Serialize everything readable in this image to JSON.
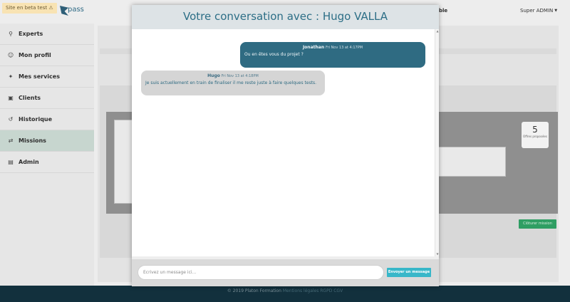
{
  "banner": {
    "text": "Site en beta test",
    "icon": "warning-icon"
  },
  "brand": {
    "logo_text": "pass"
  },
  "top_nav": {
    "partial_label": "ble"
  },
  "user_menu": {
    "label": "Super ADMIN"
  },
  "sidebar": {
    "items": [
      {
        "label": "Experts",
        "icon": "search-icon"
      },
      {
        "label": "Mon profil",
        "icon": "user-icon"
      },
      {
        "label": "Mes services",
        "icon": "tool-icon"
      },
      {
        "label": "Clients",
        "icon": "id-card-icon"
      },
      {
        "label": "Historique",
        "icon": "history-icon"
      },
      {
        "label": "Missions",
        "icon": "exchange-icon",
        "active": true
      },
      {
        "label": "Admin",
        "icon": "admin-card-icon"
      }
    ]
  },
  "mission": {
    "proposals_count": "5",
    "proposals_label": "Offres proposées",
    "close_button": "Clôturer mission"
  },
  "footer": {
    "copyright": "© 2019 Platon Formation",
    "links": "Mentions légales RGPD CGV"
  },
  "modal": {
    "title": "Votre conversation avec : Hugo VALLA",
    "messages": [
      {
        "author": "Jonathan",
        "time": "Fri Nov 13 at 4:17PM",
        "text": "Ou en êtes vous du projet ?",
        "direction": "sent"
      },
      {
        "author": "Hugo",
        "time": "Fri Nov 13 at 4:18PM",
        "text": "Je suis actuellement en train de finaliser il me reste juste à faire quelques tests.",
        "direction": "received"
      }
    ],
    "input_placeholder": "Ecrivez un message ici...",
    "send_label": "Envoyer un message"
  },
  "colors": {
    "accent": "#2c6e86",
    "sent_bubble": "#2f6b82",
    "received_bubble": "#d5d5d5",
    "send_button": "#38b7c9",
    "footer": "#12303d"
  }
}
